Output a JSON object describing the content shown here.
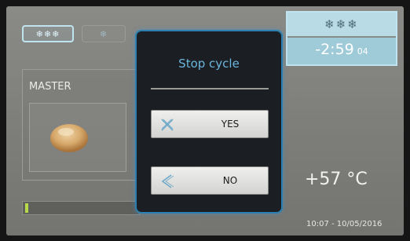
{
  "mode_chips": {
    "active": "❄❄❄",
    "faded": "❄"
  },
  "master": {
    "label": "MASTER"
  },
  "cycle": {
    "icons": "❄❄❄",
    "time_main": "-2:59",
    "time_seconds": "04"
  },
  "progress": {
    "fraction": 0.03
  },
  "temperature": "+57 °C",
  "datetime": "10:07 - 10/05/2016",
  "modal": {
    "title": "Stop cycle",
    "yes_label": "YES",
    "no_label": "NO"
  },
  "colors": {
    "accent": "#2b7fb0",
    "title_text": "#6bb6de",
    "cycle_bg": "#9fcad8",
    "progress": "#b8d94a"
  },
  "icons": {
    "yes": "cross-icon",
    "no": "back-chevron-icon",
    "mode": "snowflake-icon"
  }
}
